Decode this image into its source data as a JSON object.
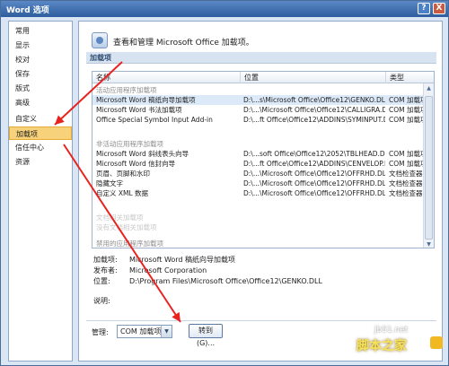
{
  "window": {
    "title": "Word 选项",
    "help_button": "?",
    "close_button": "X"
  },
  "sidebar": {
    "items": [
      {
        "label": "常用"
      },
      {
        "label": "显示"
      },
      {
        "label": "校对"
      },
      {
        "label": "保存"
      },
      {
        "label": "版式"
      },
      {
        "label": "高级"
      },
      {
        "label": "自定义"
      },
      {
        "label": "加载项"
      },
      {
        "label": "信任中心"
      },
      {
        "label": "资源"
      }
    ],
    "active_index": 7
  },
  "content": {
    "header_text": "查看和管理 Microsoft Office 加载项。",
    "section_title": "加载项",
    "columns": {
      "name": "名称",
      "location": "位置",
      "type": "类型"
    },
    "groups": [
      {
        "title": "活动应用程序加载项",
        "rows": [
          {
            "name": "Microsoft Word 稿纸向导加载项",
            "location": "D:\\...s\\Microsoft Office\\Office12\\GENKO.DLL",
            "type": "COM 加载项"
          },
          {
            "name": "Microsoft Word 书法加载项",
            "location": "D:\\...\\Microsoft Office\\Office12\\CALLIGRA.DLL",
            "type": "COM 加载项"
          },
          {
            "name": "Office Special Symbol Input Add-in",
            "location": "D:\\...ft Office\\Office12\\ADDINS\\SYMINPUT.DLL",
            "type": "COM 加载项"
          }
        ]
      },
      {
        "title": "非活动应用程序加载项",
        "rows": [
          {
            "name": "Microsoft Word 斜线表头向导",
            "location": "D:\\...soft Office\\Office12\\2052\\TBLHEAD.DLL",
            "type": "COM 加载项"
          },
          {
            "name": "Microsoft Word 信封向导",
            "location": "D:\\...ft Office\\Office12\\ADDINS\\CENVELOP.DLL",
            "type": "COM 加载项"
          },
          {
            "name": "页眉、页脚和水印",
            "location": "D:\\...\\Microsoft Office\\Office12\\OFFRHD.DLL",
            "type": "文档检查器"
          },
          {
            "name": "隐藏文字",
            "location": "D:\\...\\Microsoft Office\\Office12\\OFFRHD.DLL",
            "type": "文档检查器"
          },
          {
            "name": "自定义 XML 数据",
            "location": "D:\\...\\Microsoft Office\\Office12\\OFFRHD.DLL",
            "type": "文档检查器"
          }
        ]
      },
      {
        "title": "文档相关加载项",
        "rows": [
          {
            "name": "没有文档相关加载项",
            "location": "",
            "type": ""
          }
        ]
      },
      {
        "title": "禁用的应用程序加载项",
        "rows": []
      }
    ],
    "details": {
      "addin_label": "加载项:",
      "addin_value": "Microsoft Word 稿纸向导加载项",
      "publisher_label": "发布者:",
      "publisher_value": "Microsoft Corporation",
      "location_label": "位置:",
      "location_value": "D:\\Program Files\\Microsoft Office\\Office12\\GENKO.DLL",
      "description_label": "说明:"
    },
    "manage": {
      "label": "管理:",
      "selected": "COM 加载项",
      "go_button": "转到(G)..."
    }
  },
  "annotation": {
    "arrow_color": "#e8231f"
  },
  "watermark": {
    "url": "jb51.net",
    "brand": "脚本之家"
  }
}
